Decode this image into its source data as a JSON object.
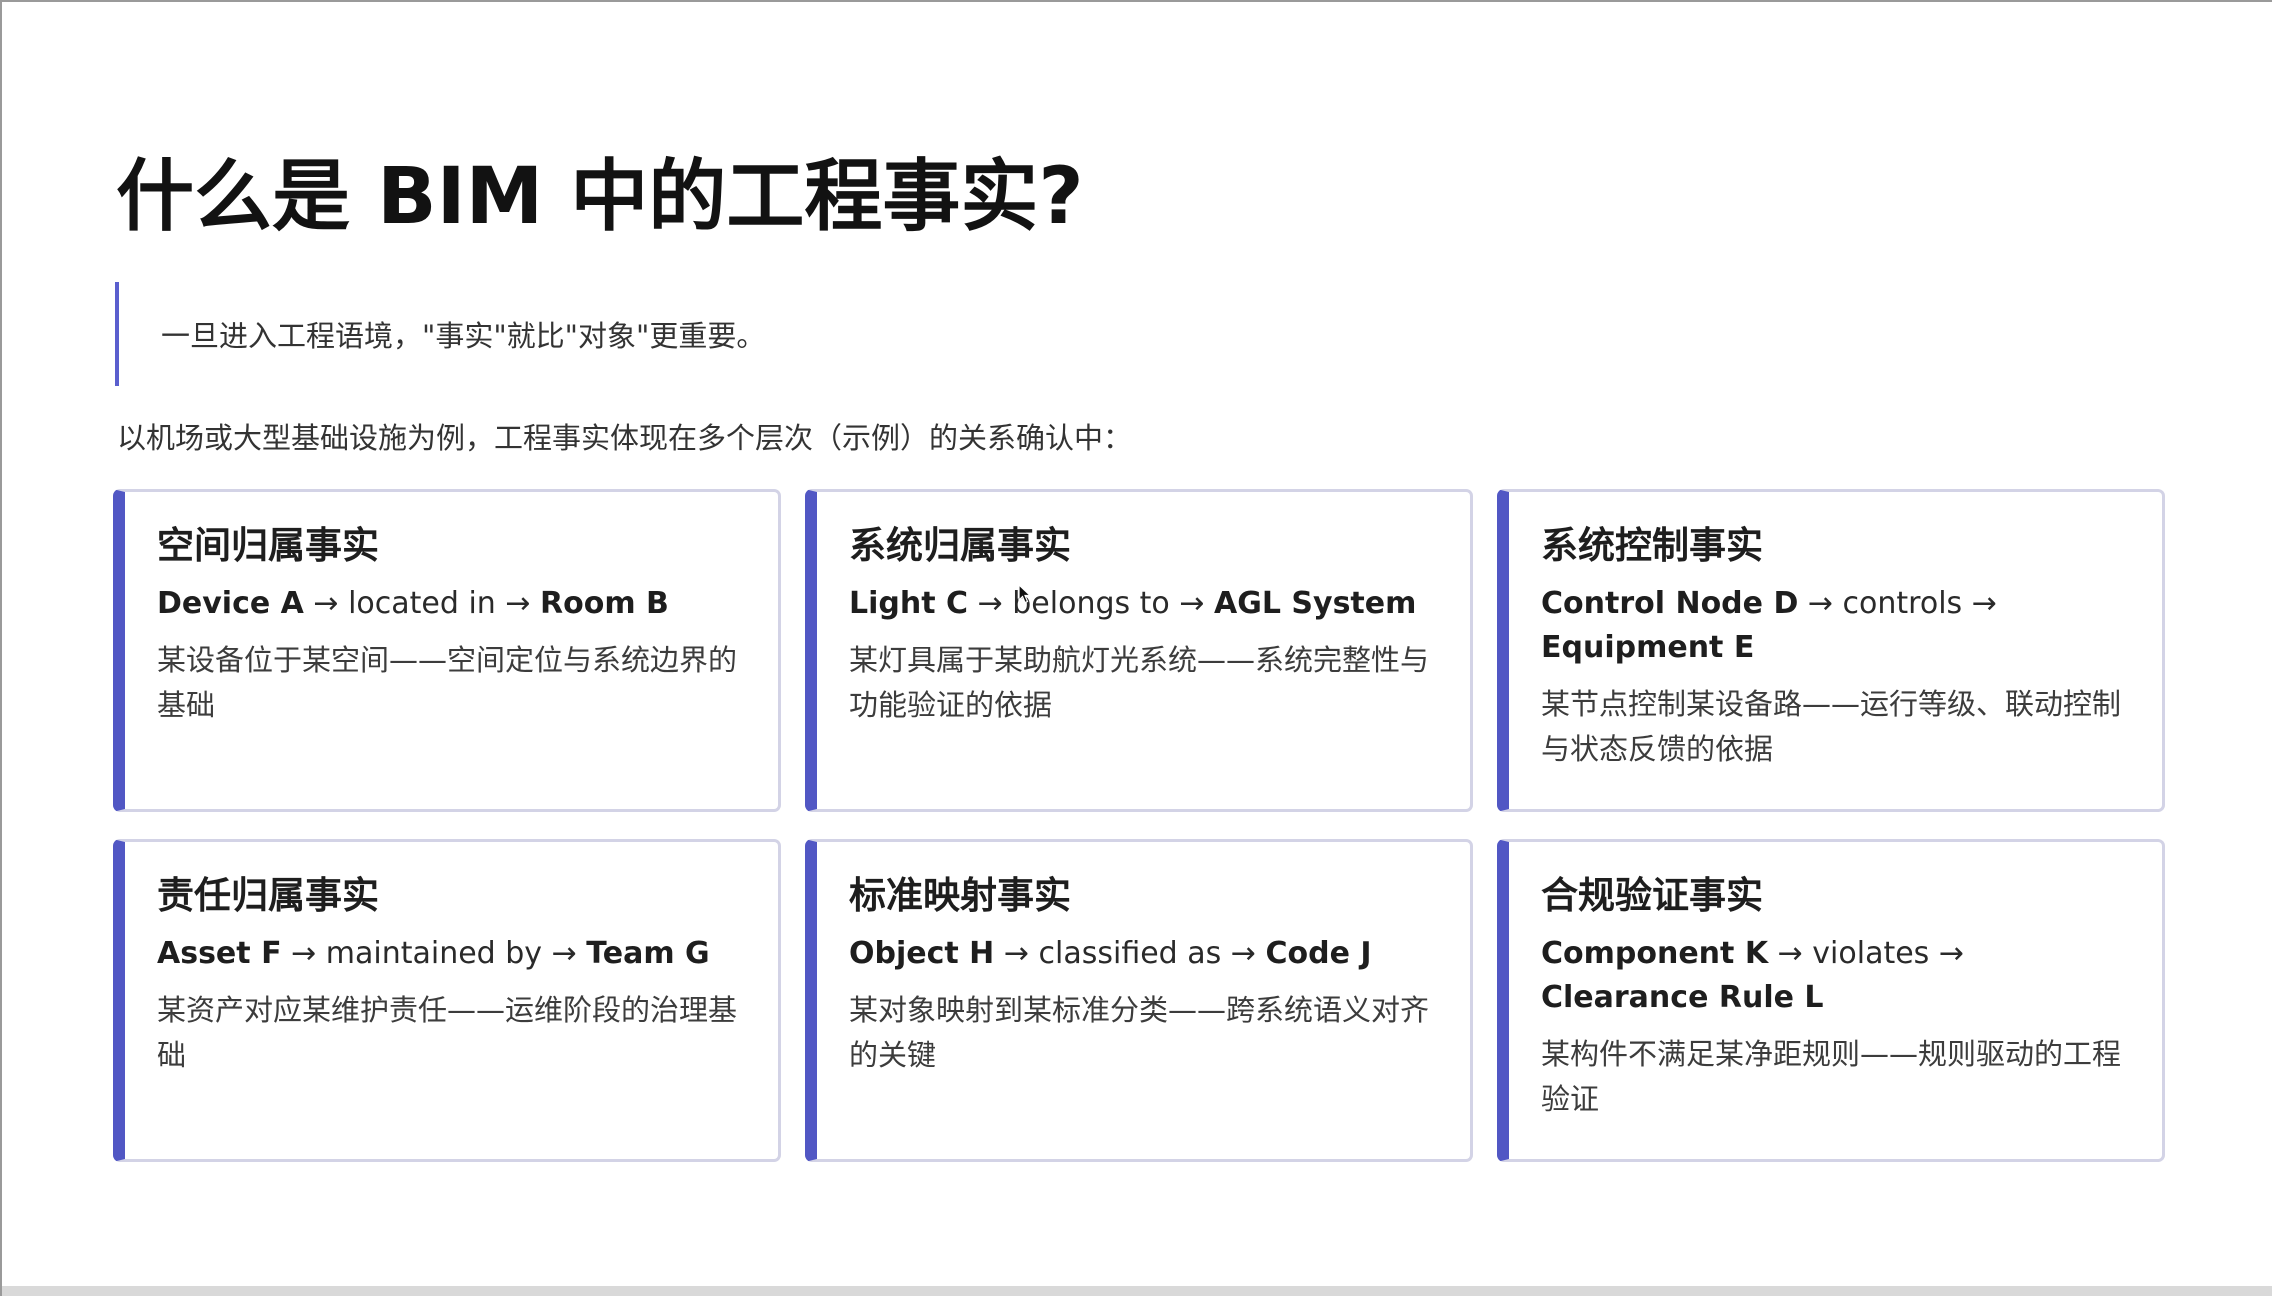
{
  "slide": {
    "title": "什么是 BIM 中的工程事实?",
    "quote": "一旦进入工程语境，\"事实\"就比\"对象\"更重要。",
    "intro": "以机场或大型基础设施为例，工程事实体现在多个层次（示例）的关系确认中："
  },
  "cards": [
    {
      "title": "空间归属事实",
      "subject": "Device A",
      "predicate": " → located in → ",
      "object": "Room B",
      "description": "某设备位于某空间——空间定位与系统边界的基础"
    },
    {
      "title": "系统归属事实",
      "subject": "Light C",
      "predicate": " → belongs to → ",
      "object": "AGL System",
      "description": "某灯具属于某助航灯光系统——系统完整性与功能验证的依据"
    },
    {
      "title": "系统控制事实",
      "subject": "Control Node D",
      "predicate": " → controls → ",
      "object": "Equipment E",
      "description": "某节点控制某设备路——运行等级、联动控制与状态反馈的依据"
    },
    {
      "title": "责任归属事实",
      "subject": "Asset F",
      "predicate": " → maintained by → ",
      "object": "Team G",
      "description": "某资产对应某维护责任——运维阶段的治理基础"
    },
    {
      "title": "标准映射事实",
      "subject": "Object H",
      "predicate": " → classified as → ",
      "object": "Code J",
      "description": "某对象映射到某标准分类——跨系统语义对齐的关键"
    },
    {
      "title": "合规验证事实",
      "subject": "Component K",
      "predicate": " → violates → ",
      "object": "Clearance Rule L",
      "description": "某构件不满足某净距规则——规则驱动的工程验证"
    }
  ],
  "colors": {
    "accent": "#5157c4",
    "card_border": "#d3d3e6",
    "title_text": "#121212",
    "body_text": "#333333"
  },
  "icons": {
    "cursor": "mouse-pointer-icon"
  }
}
